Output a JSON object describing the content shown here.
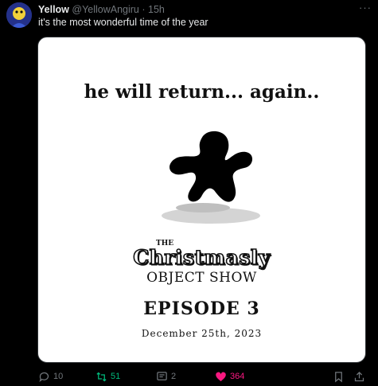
{
  "author": {
    "name": "Yellow",
    "handle": "@YellowAngiru",
    "separator": "·",
    "time": "15h"
  },
  "tweet_text": "it's the most wonderful time of the year",
  "more_label": "···",
  "media": {
    "headline": "he will return... again..",
    "logo_the": "THE",
    "logo_title": "Christmasly",
    "logo_subtitle": "OBJECT SHOW",
    "episode": "EPISODE 3",
    "date": "December 25th, 2023"
  },
  "actions": {
    "replies": "10",
    "retweets": "51",
    "views": "2",
    "likes": "364"
  },
  "colors": {
    "background": "#000000",
    "retweet": "#00ba7c",
    "like": "#f91880",
    "muted": "#71767b"
  }
}
